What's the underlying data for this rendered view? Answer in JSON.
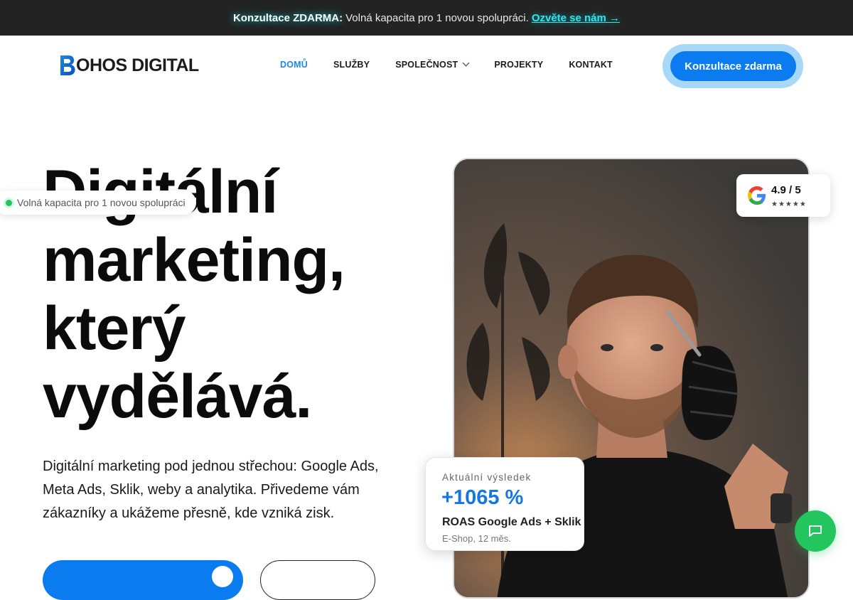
{
  "announcement": {
    "strong": "Konzultace ZDARMA:",
    "text": "Volná kapacita pro 1 novou spolupráci.",
    "link": "Ozvěte se nám →"
  },
  "header": {
    "logo_text": "OHOS DIGITAL",
    "logo_letter": "B",
    "nav": [
      {
        "label": "DOMŮ",
        "active": true
      },
      {
        "label": "SLUŽBY"
      },
      {
        "label": "SPOLEČNOST",
        "dropdown": true
      },
      {
        "label": "PROJEKTY"
      },
      {
        "label": "KONTAKT"
      }
    ],
    "cta_label": "Konzultace zdarma"
  },
  "hero": {
    "title_lines": [
      "Digitální",
      "marketing,",
      "který",
      "vydělává."
    ],
    "availability": "Volná kapacita pro 1 novou spolupráci",
    "description": "Digitální marketing pod jednou střechou: Google Ads, Meta Ads, Sklik, weby a analytika. Přivedeme vám zákazníky a ukážeme přesně, kde vzniká zisk."
  },
  "rating": {
    "score": "4.9 / 5",
    "stars": "★★★★★",
    "icon": "google-icon"
  },
  "result": {
    "label": "Aktuální výsledek",
    "value": "+1065 %",
    "metric": "ROAS Google Ads + Sklik",
    "sub": "E-Shop, 12 měs."
  },
  "colors": {
    "accent": "#0a7cf0",
    "topbar": "#232323",
    "link_glow": "#2ee6f0",
    "chat": "#22c55e"
  }
}
